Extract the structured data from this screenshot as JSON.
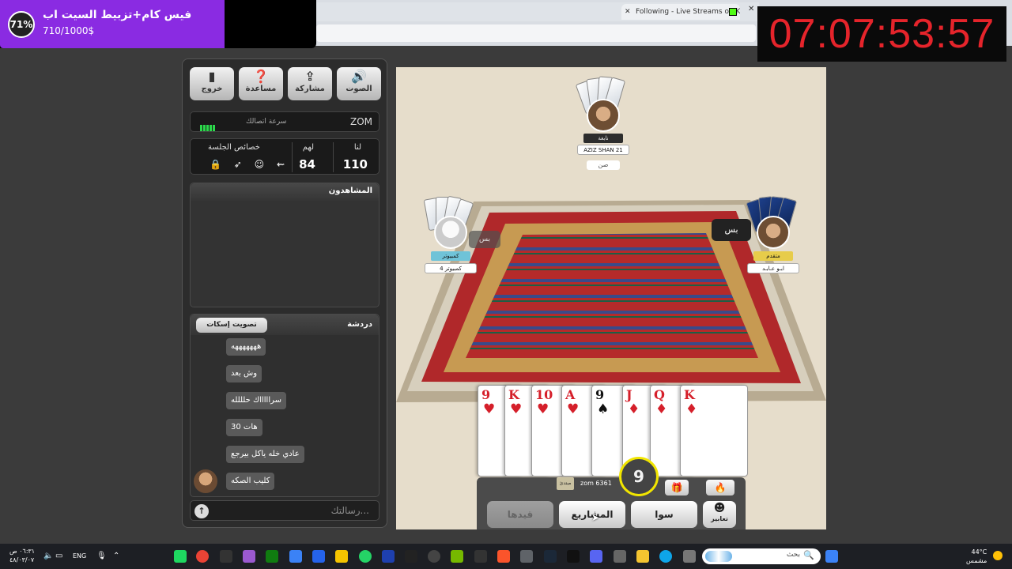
{
  "browser": {
    "new_tab": "+",
    "tab_close": "✕",
    "tab_title": "Following - Live Streams on Kick",
    "tab2_close": "✕"
  },
  "overlay": {
    "goal_percent": "71%",
    "goal_fraction": 0.71,
    "goal_title": "فيس كام+تزبيط السيت اب",
    "goal_amount": "710/1000$",
    "countdown": "07:07:53:57"
  },
  "sidebar": {
    "buttons": [
      {
        "label": "الصوت",
        "icon": "speaker-icon"
      },
      {
        "label": "مشاركة",
        "icon": "share-icon"
      },
      {
        "label": "مساعدة",
        "icon": "help-icon"
      },
      {
        "label": "خروج",
        "icon": "exit-door-icon"
      }
    ],
    "connection": {
      "user": "ZOM",
      "label": "سرعة اتصالك",
      "bars": 5
    },
    "scores": {
      "us_label": "لنا",
      "us_value": "110",
      "them_label": "لهم",
      "them_value": "84",
      "session_label": "خصائص الجلسة",
      "session_icons": "🔒 ➶ ☺ ⇜"
    },
    "viewers_title": "المشاهدون",
    "chat": {
      "title": "دردشة",
      "mute_label": "تصويت إسكات",
      "messages": [
        "هههههههه",
        "وش بعد",
        "سراااااك حلللله",
        "هات 30",
        "عادي خله ياكل بيرجع",
        "كليب الصكه"
      ],
      "placeholder": "رسالتك...",
      "send_icon": "↑"
    }
  },
  "game": {
    "players": {
      "top": {
        "rank": "نابغة",
        "name": "AZIZ SHAN 21",
        "status": "صن"
      },
      "left": {
        "rank": "كمبيوتر",
        "name": "كمبيوتر 4",
        "bubble": "بس"
      },
      "right": {
        "rank": "متقدم",
        "name": "ابـو عـابـد",
        "bubble": "بس"
      }
    },
    "hand": [
      {
        "rank": "9",
        "suit": "♥",
        "color": "red"
      },
      {
        "rank": "K",
        "suit": "♥",
        "color": "red"
      },
      {
        "rank": "10",
        "suit": "♥",
        "color": "red"
      },
      {
        "rank": "A",
        "suit": "♥",
        "color": "red"
      },
      {
        "rank": "9",
        "suit": "♠",
        "color": "blk"
      },
      {
        "rank": "J",
        "suit": "♦",
        "color": "red"
      },
      {
        "rank": "Q",
        "suit": "♦",
        "color": "red"
      },
      {
        "rank": "K",
        "suit": "♦",
        "color": "red"
      }
    ],
    "hud": {
      "turn_timer": "9",
      "my_tag": "zom 6361",
      "beginner_badge": "مبتدئ",
      "gift_icon": "🎁",
      "fire_icon": "🔥",
      "emotes_label": "تعابير",
      "emotes_icon": "☻",
      "btn_swa": "سوا",
      "btn_projects": "المشاريع",
      "btn_record": "قيدها"
    }
  },
  "taskbar": {
    "time": "٠٦:٣١ ص",
    "date": "٤٨/٠٣/٠٧",
    "lang": "ENG",
    "search_text": "بحث",
    "search_icon": "🔍",
    "weather_temp": "44°C",
    "weather_desc": "مشمس"
  },
  "colors": {
    "goal_fill": "#8a2be2",
    "countdown": "#e5242b",
    "timer_ring": "#f2e600",
    "signal": "#2bd94b"
  }
}
